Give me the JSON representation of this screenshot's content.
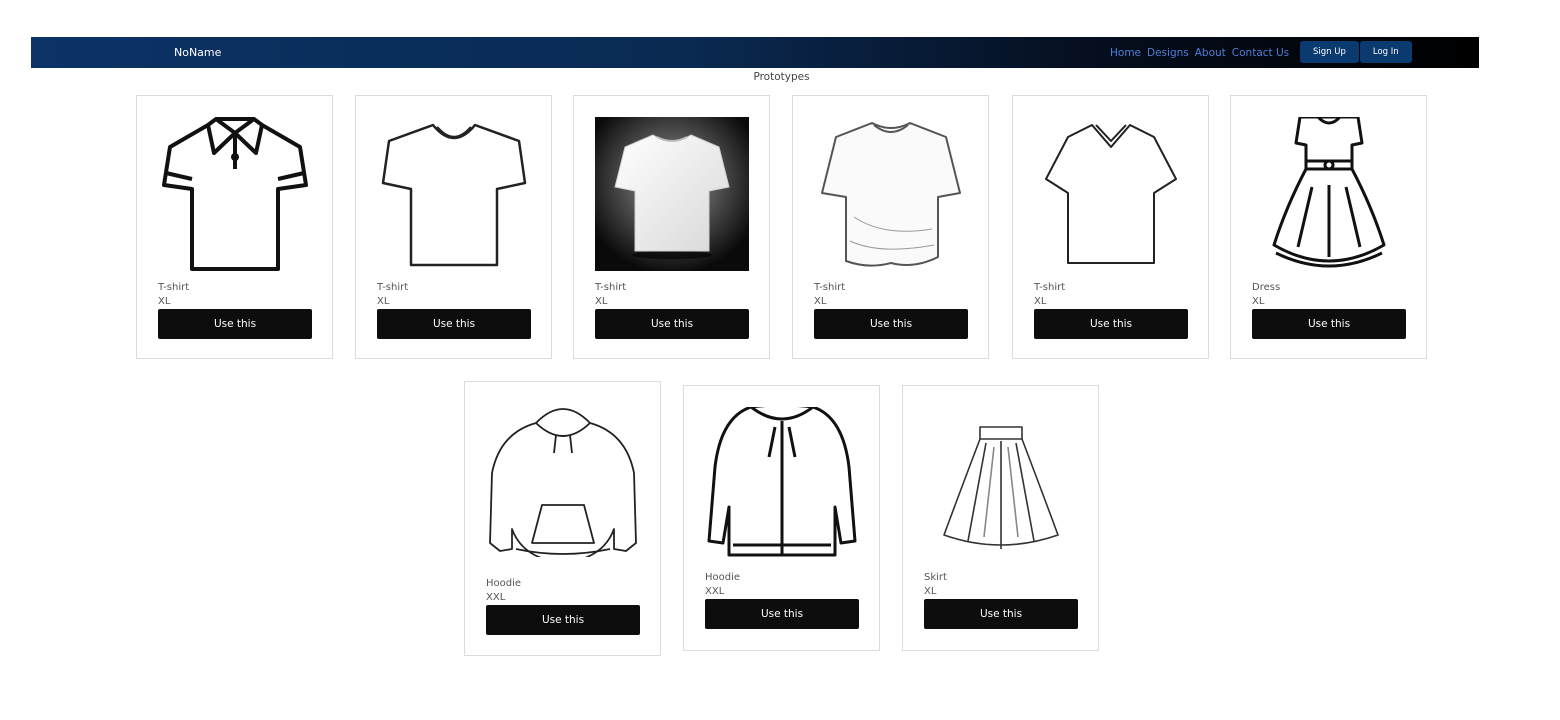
{
  "navbar": {
    "brand": "NoName",
    "links": [
      "Home",
      "Designs",
      "About",
      "Contact Us"
    ],
    "signup_label": "Sign Up",
    "login_label": "Log In"
  },
  "section_title": "Prototypes",
  "products": [
    {
      "name": "T-shirt",
      "size": "XL",
      "button": "Use this",
      "image_icon": "polo-shirt-icon"
    },
    {
      "name": "T-shirt",
      "size": "XL",
      "button": "Use this",
      "image_icon": "crew-tshirt-icon"
    },
    {
      "name": "T-shirt",
      "size": "XL",
      "button": "Use this",
      "image_icon": "white-tshirt-photo"
    },
    {
      "name": "T-shirt",
      "size": "XL",
      "button": "Use this",
      "image_icon": "tshirt-sketch-icon"
    },
    {
      "name": "T-shirt",
      "size": "XL",
      "button": "Use this",
      "image_icon": "vneck-tshirt-icon"
    },
    {
      "name": "Dress",
      "size": "XL",
      "button": "Use this",
      "image_icon": "dress-icon"
    },
    {
      "name": "Hoodie",
      "size": "XXL",
      "button": "Use this",
      "image_icon": "hoodie-pullover-icon"
    },
    {
      "name": "Hoodie",
      "size": "XXL",
      "button": "Use this",
      "image_icon": "hoodie-zip-icon"
    },
    {
      "name": "Skirt",
      "size": "XL",
      "button": "Use this",
      "image_icon": "skirt-icon"
    }
  ]
}
